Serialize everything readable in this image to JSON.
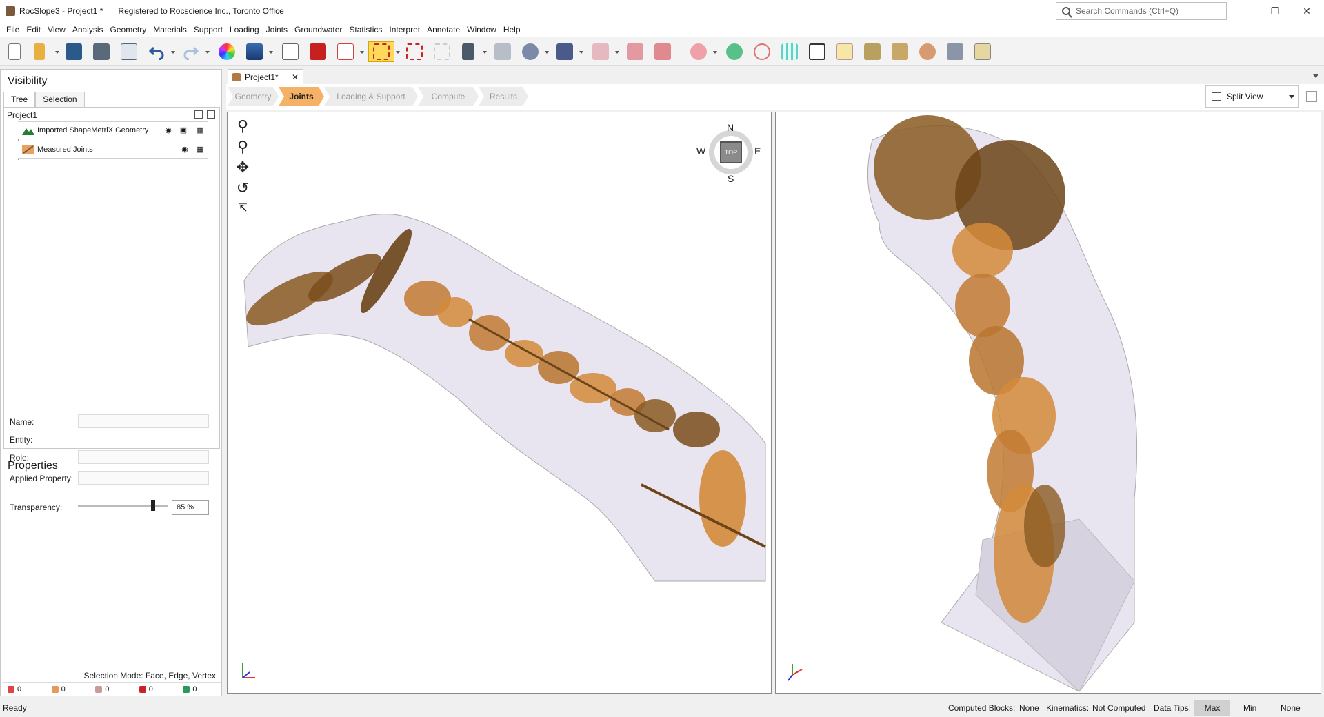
{
  "window": {
    "title": "RocSlope3 - Project1 *",
    "registration": "Registered to Rocscience Inc., Toronto Office",
    "search_placeholder": "Search Commands (Ctrl+Q)"
  },
  "menu": [
    "File",
    "Edit",
    "View",
    "Analysis",
    "Geometry",
    "Materials",
    "Support",
    "Loading",
    "Joints",
    "Groundwater",
    "Statistics",
    "Interpret",
    "Annotate",
    "Window",
    "Help"
  ],
  "visibility": {
    "header": "Visibility",
    "tabs": [
      "Tree",
      "Selection"
    ],
    "project": "Project1",
    "items": [
      {
        "label": "Imported ShapeMetriX Geometry",
        "icon": "terrain-icon"
      },
      {
        "label": "Measured Joints",
        "icon": "joints-icon"
      }
    ]
  },
  "properties": {
    "header": "Properties",
    "name_label": "Name:",
    "entity_label": "Entity:",
    "role_label": "Role:",
    "applied_label": "Applied Property:",
    "transparency_label": "Transparency:",
    "transparency_value": "85 %",
    "transparency_fraction": 0.85
  },
  "selection_mode": "Selection Mode: Face, Edge, Vertex",
  "counts": [
    {
      "value": "0",
      "color": "#d44"
    },
    {
      "value": "0",
      "color": "#e59a5a"
    },
    {
      "value": "0",
      "color": "#c99"
    },
    {
      "value": "0",
      "color": "#c22"
    },
    {
      "value": "0",
      "color": "#2a9a5a"
    }
  ],
  "document": {
    "tab": "Project1*",
    "workflow": [
      "Geometry",
      "Joints",
      "Loading & Support",
      "Compute",
      "Results"
    ],
    "active_step": "Joints",
    "view_mode": "Split View"
  },
  "compass": {
    "n": "N",
    "s": "S",
    "e": "E",
    "w": "W",
    "center": "TOP"
  },
  "status": {
    "ready": "Ready",
    "computed_blocks_label": "Computed Blocks:",
    "computed_blocks_value": "None",
    "kinematics_label": "Kinematics:",
    "kinematics_value": "Not Computed",
    "data_tips_label": "Data Tips:",
    "data_tips_options": [
      "Max",
      "Min",
      "None"
    ],
    "data_tips_selected": "Max"
  },
  "colors": {
    "accent_step": "#f5b165",
    "joint_fill": "#d48a3a",
    "joint_dark": "#6b4418",
    "rock_mass": "#e8e4f0"
  }
}
